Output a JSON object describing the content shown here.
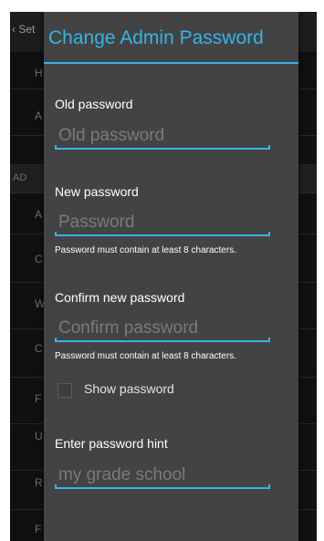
{
  "background": {
    "back_label": "Set",
    "rows": [
      "H",
      "A",
      "",
      "A",
      "C",
      "W",
      "C",
      "F",
      "U",
      "R",
      "F"
    ],
    "section_header": "AD"
  },
  "dialog": {
    "title": "Change Admin Password",
    "old_password": {
      "label": "Old password",
      "placeholder": "Old password"
    },
    "new_password": {
      "label": "New password",
      "placeholder": "Password",
      "hint": "Password must contain at least 8 characters."
    },
    "confirm_password": {
      "label": "Confirm new password",
      "placeholder": "Confirm password",
      "hint": "Password must contain at least 8 characters."
    },
    "show_password": {
      "label": "Show password",
      "checked": false
    },
    "password_hint": {
      "label": "Enter password hint",
      "placeholder": "my grade school"
    }
  },
  "colors": {
    "accent": "#33b5e5",
    "dialog_bg": "#434343",
    "placeholder": "#7a7a7a"
  }
}
